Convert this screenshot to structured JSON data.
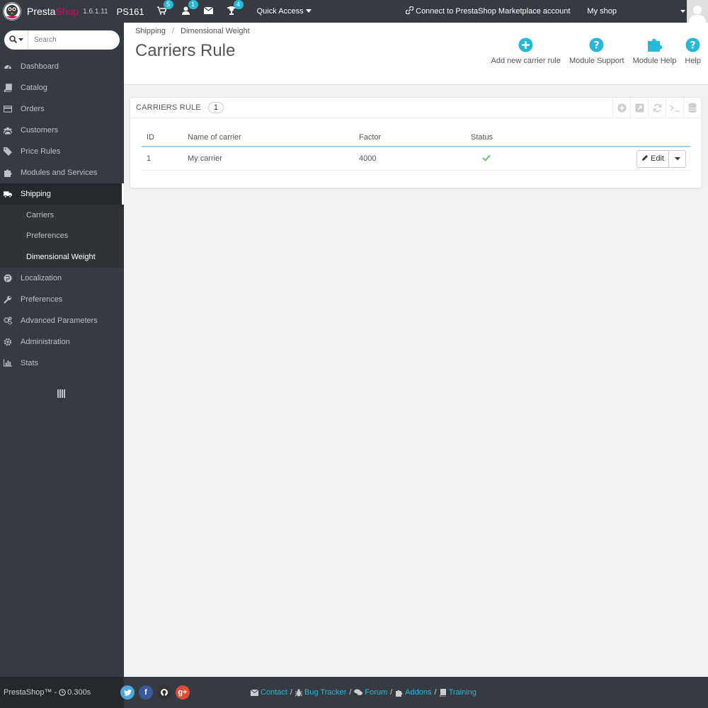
{
  "topbar": {
    "brand_presta": "Presta",
    "brand_shop": "Shop",
    "version": "1.6.1.11",
    "shop_code": "PS161",
    "cart_badge": "5",
    "customers_badge": "1",
    "trophy_badge": "4",
    "quick_access": "Quick Access",
    "connect": "Connect to PrestaShop Marketplace account",
    "my_shop": "My shop"
  },
  "sidebar": {
    "search_placeholder": "Search",
    "items": [
      {
        "label": "Dashboard",
        "icon": "dashboard-icon"
      },
      {
        "label": "Catalog",
        "icon": "book-icon"
      },
      {
        "label": "Orders",
        "icon": "credit-card-icon"
      },
      {
        "label": "Customers",
        "icon": "users-icon"
      },
      {
        "label": "Price Rules",
        "icon": "tags-icon"
      },
      {
        "label": "Modules and Services",
        "icon": "puzzle-icon"
      },
      {
        "label": "Shipping",
        "icon": "truck-icon"
      },
      {
        "label": "Localization",
        "icon": "globe-icon"
      },
      {
        "label": "Preferences",
        "icon": "wrench-icon"
      },
      {
        "label": "Advanced Parameters",
        "icon": "cogs-icon"
      },
      {
        "label": "Administration",
        "icon": "gear-icon"
      },
      {
        "label": "Stats",
        "icon": "bar-chart-icon"
      }
    ],
    "shipping_sub": [
      "Carriers",
      "Preferences",
      "Dimensional Weight"
    ]
  },
  "header": {
    "breadcrumb": [
      "Shipping",
      "Dimensional Weight"
    ],
    "title": "Carriers Rule",
    "toolbar": {
      "add": "Add new carrier rule",
      "module_support": "Module Support",
      "module_help": "Module Help",
      "help": "Help"
    }
  },
  "panel": {
    "title": "CARRIERS RULE",
    "count": "1",
    "columns": [
      "ID",
      "Name of carrier",
      "Factor",
      "Status"
    ],
    "rows": [
      {
        "id": "1",
        "name": "My carrier",
        "factor": "4000",
        "status": "enabled"
      }
    ],
    "edit_label": "Edit"
  },
  "footer": {
    "brand": "PrestaShop™",
    "time": "0.300s",
    "links": [
      "Contact",
      "Bug Tracker",
      "Forum",
      "Addons",
      "Training"
    ]
  },
  "colors": {
    "accent": "#25b9d7",
    "brand_pink": "#df0067",
    "sidebar_bg": "#363a41",
    "status_ok": "#72c279"
  }
}
